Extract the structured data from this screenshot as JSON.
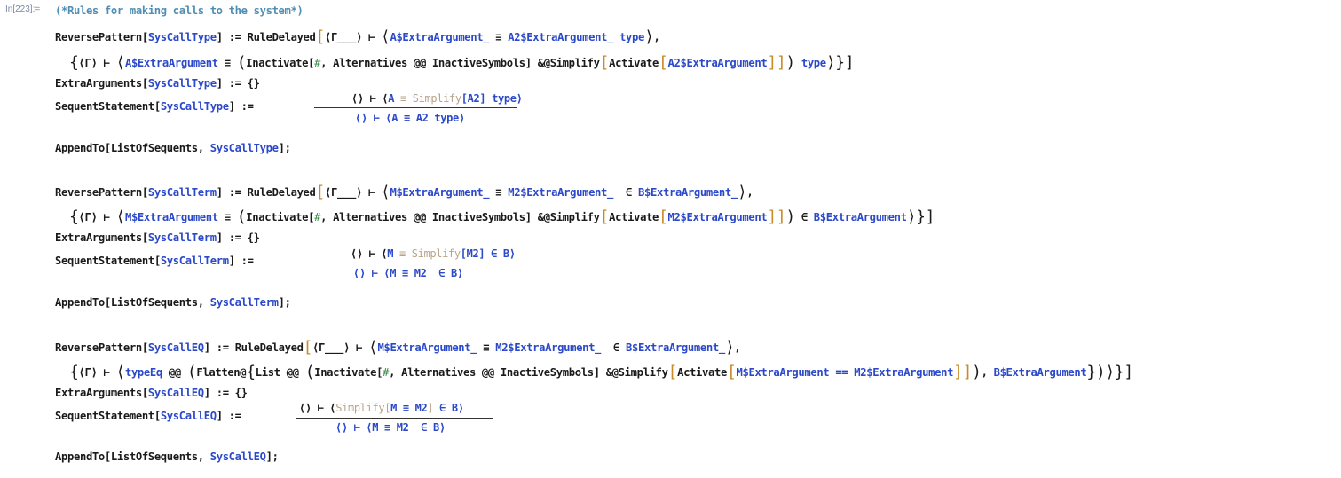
{
  "cell": {
    "in_label": "In[223]:=",
    "comment": "(*Rules for making calls to the system*)"
  },
  "blocks": [
    {
      "name": "SysCallType",
      "reverse_pattern": {
        "lhs_head": "ReversePattern",
        "arg": "SysCallType",
        "assign": ":=",
        "rule": "RuleDelayed",
        "gamma_pattern": "⟨Γ___⟩ ⊢",
        "lhs_pattern_a": "A$ExtraArgument_",
        "equiv": "≡",
        "lhs_pattern_b": "A2$ExtraArgument_",
        "tail": "type",
        "rhs_gamma": "⟨Γ⟩ ⊢",
        "rhs_var": "A$ExtraArgument",
        "inactivate": "Inactivate",
        "slot": "#",
        "alternatives": "Alternatives @@ InactiveSymbols",
        "amp": "&@Simplify",
        "activate": "Activate",
        "activate_arg": "A2$ExtraArgument",
        "rhs_tail": "type"
      },
      "extra_arguments": {
        "head": "ExtraArguments",
        "arg": "SysCallType",
        "value": ":= {}"
      },
      "sequent": {
        "head": "SequentStatement",
        "arg": "SysCallType",
        "numerator": {
          "pre": "⟨⟩ ⊢ ⟨",
          "var": "A",
          "eq": "≡",
          "simplify": "Simplify",
          "inner": "A2",
          "post": "type⟩"
        },
        "denominator": "⟨⟩ ⊢ ⟨A ≡ A2 type⟩"
      },
      "append": {
        "head": "AppendTo",
        "list": "ListOfSequents",
        "arg": "SysCallType"
      }
    },
    {
      "name": "SysCallTerm",
      "reverse_pattern": {
        "lhs_head": "ReversePattern",
        "arg": "SysCallTerm",
        "assign": ":=",
        "rule": "RuleDelayed",
        "gamma_pattern": "⟨Γ___⟩ ⊢",
        "lhs_pattern_a": "M$ExtraArgument_",
        "equiv": "≡",
        "lhs_pattern_b": "M2$ExtraArgument_",
        "elem": "∈",
        "lhs_pattern_c": "B$ExtraArgument_",
        "rhs_gamma": "⟨Γ⟩ ⊢",
        "rhs_var": "M$ExtraArgument",
        "inactivate": "Inactivate",
        "slot": "#",
        "alternatives": "Alternatives @@ InactiveSymbols",
        "amp": "&@Simplify",
        "activate": "Activate",
        "activate_arg": "M2$ExtraArgument",
        "rhs_tail": "B$ExtraArgument"
      },
      "extra_arguments": {
        "head": "ExtraArguments",
        "arg": "SysCallTerm",
        "value": ":= {}"
      },
      "sequent": {
        "head": "SequentStatement",
        "arg": "SysCallTerm",
        "numerator": {
          "pre": "⟨⟩ ⊢ ⟨",
          "var": "M",
          "eq": "≡",
          "simplify": "Simplify",
          "inner": "M2",
          "post": "∈ B⟩"
        },
        "denominator": "⟨⟩ ⊢ ⟨M ≡ M2  ∈ B⟩"
      },
      "append": {
        "head": "AppendTo",
        "list": "ListOfSequents",
        "arg": "SysCallTerm"
      }
    },
    {
      "name": "SysCallEQ",
      "reverse_pattern": {
        "lhs_head": "ReversePattern",
        "arg": "SysCallEQ",
        "assign": ":=",
        "rule": "RuleDelayed",
        "gamma_pattern": "⟨Γ___⟩ ⊢",
        "lhs_pattern_a": "M$ExtraArgument_",
        "equiv": "≡",
        "lhs_pattern_b": "M2$ExtraArgument_",
        "elem": "∈",
        "lhs_pattern_c": "B$ExtraArgument_",
        "rhs_gamma": "⟨Γ⟩ ⊢",
        "type_eq": "typeEq",
        "apply": "@@",
        "flatten": "Flatten@",
        "list": "List @@",
        "inactivate": "Inactivate",
        "slot": "#",
        "alternatives": "Alternatives @@ InactiveSymbols",
        "amp": "&@Simplify",
        "activate": "Activate",
        "activate_arg_a": "M$ExtraArgument",
        "activate_op": "==",
        "activate_arg_b": "M2$ExtraArgument",
        "rhs_tail": "B$ExtraArgument"
      },
      "extra_arguments": {
        "head": "ExtraArguments",
        "arg": "SysCallEQ",
        "value": ":= {}"
      },
      "sequent": {
        "head": "SequentStatement",
        "arg": "SysCallEQ",
        "numerator": {
          "pre": "⟨⟩ ⊢ ⟨",
          "simplify": "Simplify",
          "inner": "M ≡ M2",
          "post": "∈ B⟩"
        },
        "denominator": "⟨⟩ ⊢ ⟨M ≡ M2  ∈ B⟩"
      },
      "append": {
        "head": "AppendTo",
        "list": "ListOfSequents",
        "arg": "SysCallEQ"
      }
    }
  ],
  "colors": {
    "text": "#1a1a1a",
    "comment": "#4f8fb3",
    "symbol": "#2b49c8",
    "slot": "#3b8a4a",
    "inactive_gray": "#b8a48a",
    "bracket": "#c98a28",
    "in_label": "#7b8aa0"
  }
}
